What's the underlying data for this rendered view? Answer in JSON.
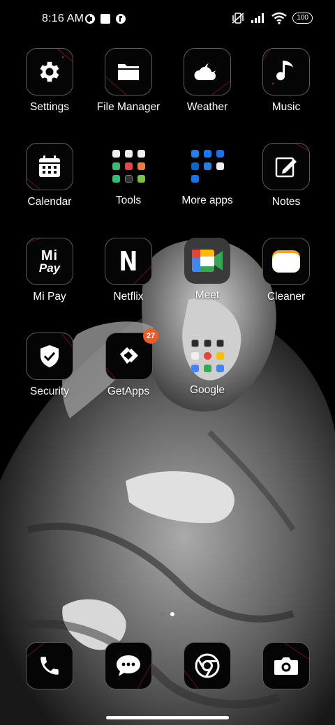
{
  "status_bar": {
    "time": "8:16 AM",
    "battery": "100"
  },
  "apps": [
    {
      "label": "Settings",
      "icon": "gear-icon"
    },
    {
      "label": "File Manager",
      "icon": "folder-icon"
    },
    {
      "label": "Weather",
      "icon": "cloud-moon-icon"
    },
    {
      "label": "Music",
      "icon": "music-note-icon"
    },
    {
      "label": "Calendar",
      "icon": "calendar-icon"
    },
    {
      "label": "Tools",
      "icon": "folder-grid-icon"
    },
    {
      "label": "More apps",
      "icon": "folder-grid-icon"
    },
    {
      "label": "Notes",
      "icon": "note-pencil-icon"
    },
    {
      "label": "Mi Pay",
      "icon": "mi-pay-icon"
    },
    {
      "label": "Netflix",
      "icon": "netflix-icon"
    },
    {
      "label": "Meet",
      "icon": "meet-icon"
    },
    {
      "label": "Cleaner",
      "icon": "cleaner-icon"
    },
    {
      "label": "Security",
      "icon": "shield-icon"
    },
    {
      "label": "GetApps",
      "icon": "getapps-icon",
      "badge": "27"
    },
    {
      "label": "Google",
      "icon": "folder-grid-icon"
    }
  ],
  "mipay_text": {
    "line1": "Mi",
    "line2": "Pay"
  },
  "netflix_text": "N",
  "dock": [
    {
      "icon": "phone-icon"
    },
    {
      "icon": "messages-icon"
    },
    {
      "icon": "chrome-icon"
    },
    {
      "icon": "camera-icon"
    }
  ],
  "colors": {
    "tile_border": "#5b5b5b",
    "badge": "#f05a24",
    "glint": "#c0203a"
  },
  "pager": {
    "pages": 2,
    "current": 2
  }
}
